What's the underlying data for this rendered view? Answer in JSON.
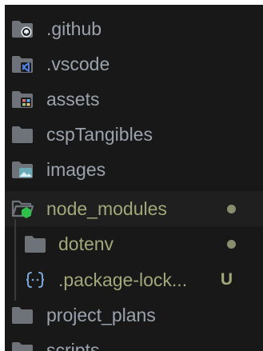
{
  "colors": {
    "panel_bg": "#181818",
    "active_row_bg": "#1f1f1f",
    "folder_icon": "#6d7378",
    "text_default": "#9aa3ad",
    "text_modified": "#a3a87a",
    "modified_dot": "#8a8d6e",
    "json_icon": "#7aa7d8",
    "node_green": "#2fbf4b",
    "github_badge": "#e9eef2",
    "vscode_badge": "#4f7fe0",
    "images_badge": "#6aa9b8",
    "assets_grid": [
      "#e06c75",
      "#61afef",
      "#98c379",
      "#e5c07b"
    ]
  },
  "explorer": {
    "items": [
      {
        "label": ".github",
        "icon": "folder-github-icon"
      },
      {
        "label": ".vscode",
        "icon": "folder-vscode-icon"
      },
      {
        "label": "assets",
        "icon": "folder-assets-icon"
      },
      {
        "label": "cspTangibles",
        "icon": "folder-icon"
      },
      {
        "label": "images",
        "icon": "folder-images-icon"
      },
      {
        "label": "node_modules",
        "icon": "folder-node-open-icon",
        "state": "modified-dot"
      },
      {
        "label": "dotenv",
        "icon": "folder-icon",
        "state": "modified-dot"
      },
      {
        "label": ".package-lock...",
        "icon": "json-braces-icon",
        "status": "U"
      },
      {
        "label": "project_plans",
        "icon": "folder-icon"
      },
      {
        "label": "scripts",
        "icon": "folder-icon"
      }
    ]
  }
}
